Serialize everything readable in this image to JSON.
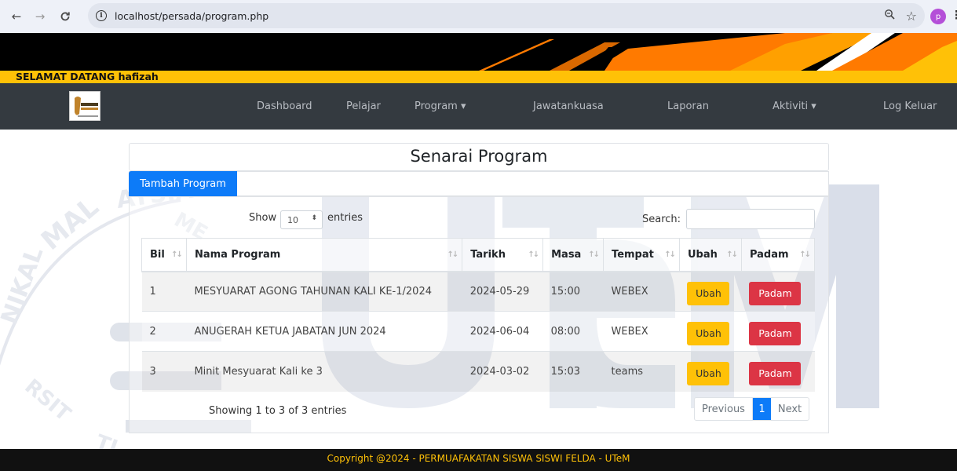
{
  "browser": {
    "url": "localhost/persada/program.php",
    "profile_initial": "p"
  },
  "site": {
    "welcome": "SELAMAT DATANG hafizah",
    "nav": [
      {
        "label": "Dashboard"
      },
      {
        "label": "Pelajar"
      },
      {
        "label": "Program ▾"
      },
      {
        "label": "Jawatankuasa"
      },
      {
        "label": "Laporan"
      },
      {
        "label": "Aktiviti ▾"
      },
      {
        "label": "Log Keluar"
      }
    ],
    "logo_text": "PERSADA"
  },
  "page": {
    "title": "Senarai Program",
    "add_button": "Tambah Program"
  },
  "table_controls": {
    "show_label": "Show",
    "entries_value": "10",
    "entries_label": "entries",
    "search_label": "Search:",
    "search_value": ""
  },
  "table": {
    "headers": [
      "Bil",
      "Nama Program",
      "Tarikh",
      "Masa",
      "Tempat",
      "Ubah",
      "Padam"
    ],
    "rows": [
      {
        "bil": "1",
        "nama": "MESYUARAT AGONG TAHUNAN KALI KE-1/2024",
        "tarikh": "2024-05-29",
        "masa": "15:00",
        "tempat": "WEBEX"
      },
      {
        "bil": "2",
        "nama": "ANUGERAH KETUA JABATAN JUN 2024",
        "tarikh": "2024-06-04",
        "masa": "08:00",
        "tempat": "WEBEX"
      },
      {
        "bil": "3",
        "nama": "Minit Mesyuarat Kali ke 3",
        "tarikh": "2024-03-02",
        "masa": "15:03",
        "tempat": "teams"
      }
    ],
    "edit_label": "Ubah",
    "delete_label": "Padam"
  },
  "info": "Showing 1 to 3 of 3 entries",
  "pagination": {
    "previous": "Previous",
    "current": "1",
    "next": "Next"
  },
  "footer": "Copyright @2024 - PERMUAFAKATAN SISWA SISWI FELDA - UTeM",
  "colors": {
    "yellow": "#ffc107",
    "navbar": "#343a40",
    "primary": "#0d7bf8",
    "danger": "#dc3545",
    "orange": "#ff7a00"
  }
}
